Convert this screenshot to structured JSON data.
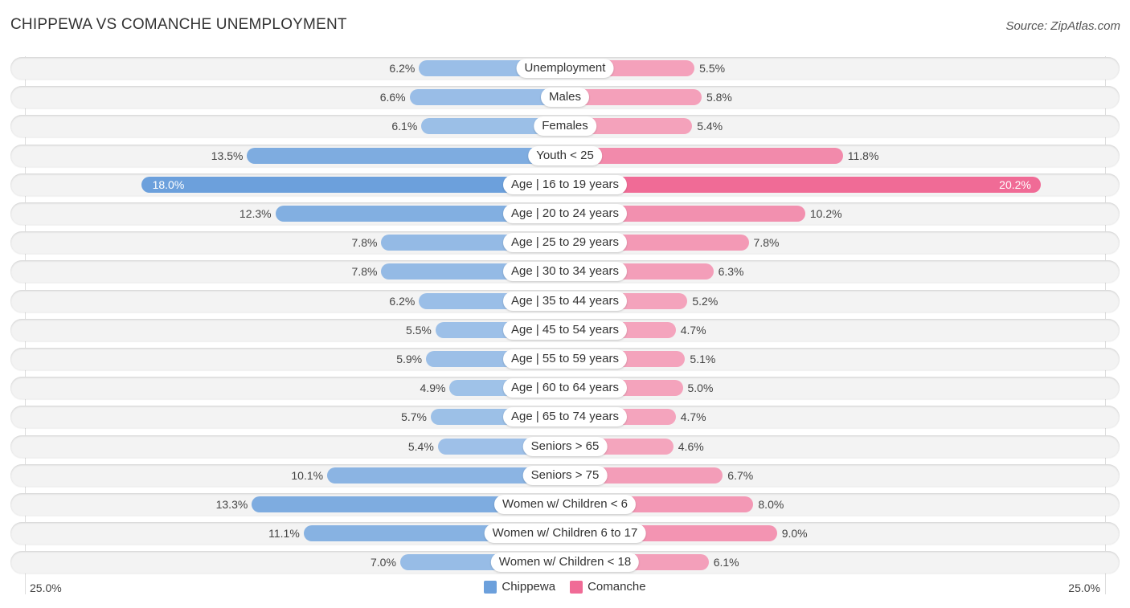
{
  "title": "CHIPPEWA VS COMANCHE UNEMPLOYMENT",
  "source": "Source: ZipAtlas.com",
  "colors": {
    "chippewa": "#a3c4e9",
    "chippewa_strong": "#6ca0dc",
    "comanche": "#f4a7bf",
    "comanche_strong": "#f06b96"
  },
  "axis": {
    "left_label": "25.0%",
    "right_label": "25.0%"
  },
  "legend": [
    {
      "name": "Chippewa",
      "color": "#6ca0dc"
    },
    {
      "name": "Comanche",
      "color": "#f06b96"
    }
  ],
  "chart_data": {
    "type": "bar",
    "orientation": "horizontal-diverging",
    "title": "CHIPPEWA VS COMANCHE UNEMPLOYMENT",
    "xlim": [
      -25,
      25
    ],
    "xlabel": "",
    "ylabel": "",
    "legend_position": "bottom-center",
    "categories": [
      "Unemployment",
      "Males",
      "Females",
      "Youth < 25",
      "Age | 16 to 19 years",
      "Age | 20 to 24 years",
      "Age | 25 to 29 years",
      "Age | 30 to 34 years",
      "Age | 35 to 44 years",
      "Age | 45 to 54 years",
      "Age | 55 to 59 years",
      "Age | 60 to 64 years",
      "Age | 65 to 74 years",
      "Seniors > 65",
      "Seniors > 75",
      "Women w/ Children < 6",
      "Women w/ Children 6 to 17",
      "Women w/ Children < 18"
    ],
    "series": [
      {
        "name": "Chippewa",
        "values": [
          6.2,
          6.6,
          6.1,
          13.5,
          18.0,
          12.3,
          7.8,
          7.8,
          6.2,
          5.5,
          5.9,
          4.9,
          5.7,
          5.4,
          10.1,
          13.3,
          11.1,
          7.0
        ]
      },
      {
        "name": "Comanche",
        "values": [
          5.5,
          5.8,
          5.4,
          11.8,
          20.2,
          10.2,
          7.8,
          6.3,
          5.2,
          4.7,
          5.1,
          5.0,
          4.7,
          4.6,
          6.7,
          8.0,
          9.0,
          6.1
        ]
      }
    ],
    "value_labels": {
      "Chippewa": [
        "6.2%",
        "6.6%",
        "6.1%",
        "13.5%",
        "18.0%",
        "12.3%",
        "7.8%",
        "7.8%",
        "6.2%",
        "5.5%",
        "5.9%",
        "4.9%",
        "5.7%",
        "5.4%",
        "10.1%",
        "13.3%",
        "11.1%",
        "7.0%"
      ],
      "Comanche": [
        "5.5%",
        "5.8%",
        "5.4%",
        "11.8%",
        "20.2%",
        "10.2%",
        "7.8%",
        "6.3%",
        "5.2%",
        "4.7%",
        "5.1%",
        "5.0%",
        "4.7%",
        "4.6%",
        "6.7%",
        "8.0%",
        "9.0%",
        "6.1%"
      ]
    }
  }
}
